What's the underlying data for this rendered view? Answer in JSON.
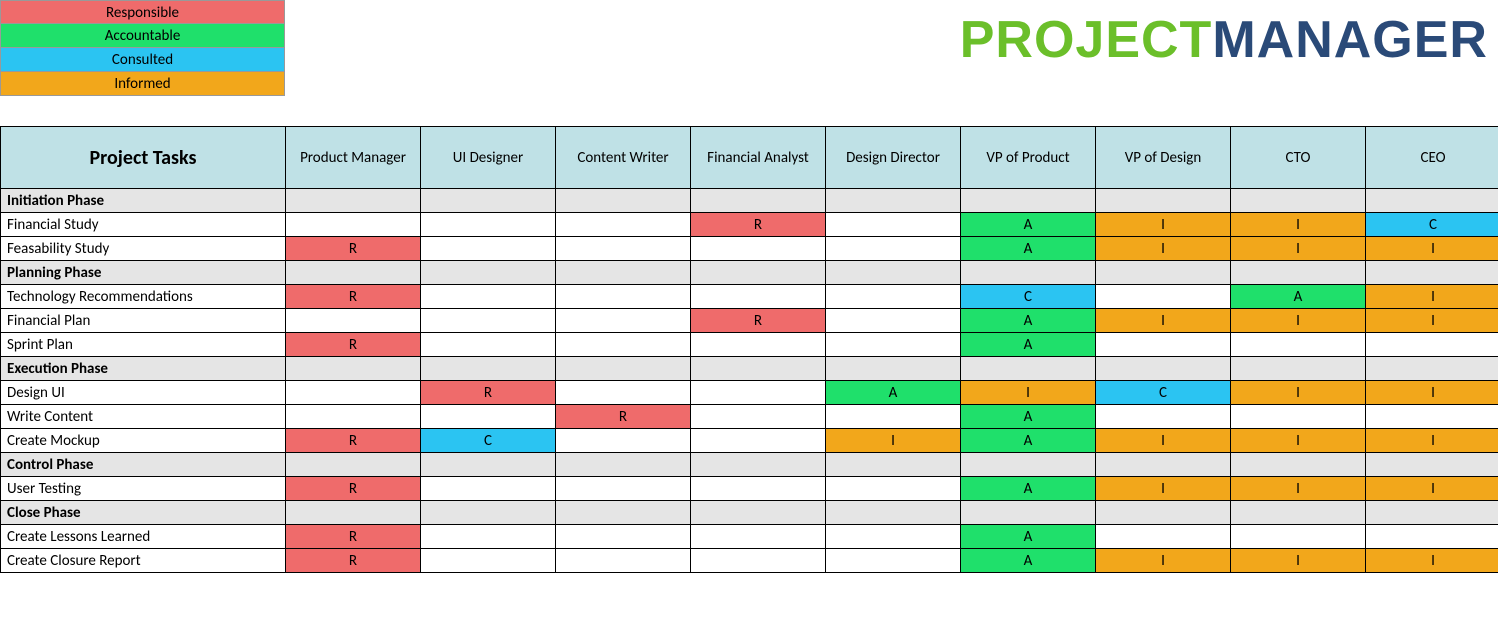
{
  "legend": {
    "R": "Responsible",
    "A": "Accountable",
    "C": "Consulted",
    "I": "Informed"
  },
  "brand": {
    "part1": "PROJECT",
    "part2": "MANAGER"
  },
  "tasks_header": "Project Tasks",
  "roles": [
    "Product Manager",
    "UI Designer",
    "Content Writer",
    "Financial Analyst",
    "Design Director",
    "VP of Product",
    "VP of Design",
    "CTO",
    "CEO"
  ],
  "rows": [
    {
      "type": "phase",
      "label": "Initiation Phase"
    },
    {
      "type": "task",
      "label": "Financial Study",
      "cells": [
        "",
        "",
        "",
        "R",
        "",
        "A",
        "I",
        "I",
        "C"
      ]
    },
    {
      "type": "task",
      "label": "Feasability Study",
      "cells": [
        "R",
        "",
        "",
        "",
        "",
        "A",
        "I",
        "I",
        "I"
      ]
    },
    {
      "type": "phase",
      "label": "Planning Phase"
    },
    {
      "type": "task",
      "label": "Technology Recommendations",
      "cells": [
        "R",
        "",
        "",
        "",
        "",
        "C",
        "",
        "A",
        "I"
      ]
    },
    {
      "type": "task",
      "label": "Financial Plan",
      "cells": [
        "",
        "",
        "",
        "R",
        "",
        "A",
        "I",
        "I",
        "I"
      ]
    },
    {
      "type": "task",
      "label": "Sprint Plan",
      "cells": [
        "R",
        "",
        "",
        "",
        "",
        "A",
        "",
        "",
        ""
      ]
    },
    {
      "type": "phase",
      "label": "Execution Phase"
    },
    {
      "type": "task",
      "label": "Design UI",
      "cells": [
        "",
        "R",
        "",
        "",
        "A",
        "I",
        "C",
        "I",
        "I"
      ]
    },
    {
      "type": "task",
      "label": "Write Content",
      "cells": [
        "",
        "",
        "R",
        "",
        "",
        "A",
        "",
        "",
        ""
      ]
    },
    {
      "type": "task",
      "label": "Create Mockup",
      "cells": [
        "R",
        "C",
        "",
        "",
        "I",
        "A",
        "I",
        "I",
        "I"
      ]
    },
    {
      "type": "phase",
      "label": "Control Phase"
    },
    {
      "type": "task",
      "label": "User Testing",
      "cells": [
        "R",
        "",
        "",
        "",
        "",
        "A",
        "I",
        "I",
        "I"
      ]
    },
    {
      "type": "phase",
      "label": "Close Phase"
    },
    {
      "type": "task",
      "label": "Create Lessons Learned",
      "cells": [
        "R",
        "",
        "",
        "",
        "",
        "A",
        "",
        "",
        ""
      ]
    },
    {
      "type": "task",
      "label": "Create Closure Report",
      "cells": [
        "R",
        "",
        "",
        "",
        "",
        "A",
        "I",
        "I",
        "I"
      ]
    }
  ]
}
